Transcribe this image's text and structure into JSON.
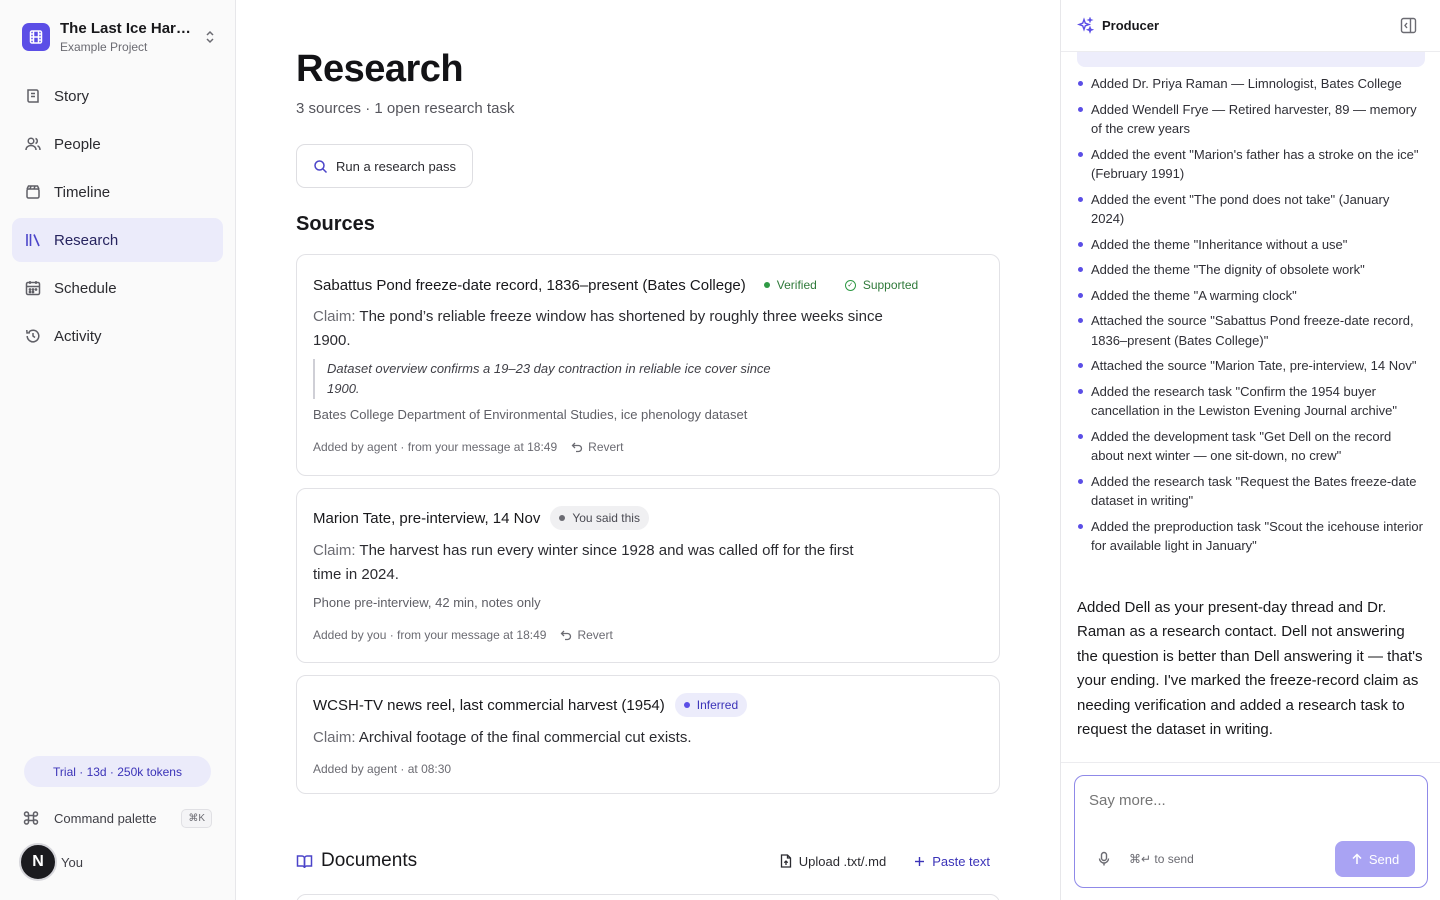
{
  "project": {
    "name": "The Last Ice Harvest",
    "subtitle": "Example Project"
  },
  "nav": [
    {
      "label": "Story",
      "icon": "story-icon",
      "active": false
    },
    {
      "label": "People",
      "icon": "people-icon",
      "active": false
    },
    {
      "label": "Timeline",
      "icon": "timeline-icon",
      "active": false
    },
    {
      "label": "Research",
      "icon": "research-icon",
      "active": true
    },
    {
      "label": "Schedule",
      "icon": "calendar-icon",
      "active": false
    },
    {
      "label": "Activity",
      "icon": "history-icon",
      "active": false
    }
  ],
  "trial": "Trial · 13d · 250k tokens",
  "command_palette": {
    "label": "Command palette",
    "shortcut": "⌘K"
  },
  "user": {
    "initial": "N",
    "name": "You"
  },
  "page": {
    "title": "Research",
    "subtitle": "3 sources · 1 open research task",
    "research_button": "Run a research pass",
    "sources_title": "Sources"
  },
  "sources": [
    {
      "title": "Sabattus Pond freeze-date record, 1836–present (Bates College)",
      "badges": [
        "Verified",
        "Supported"
      ],
      "claim_label": "Claim:",
      "claim": "The pond’s reliable freeze window has shortened by roughly three weeks since 1900.",
      "quote": "Dataset overview confirms a 19–23 day contraction in reliable ice cover since 1900.",
      "note": "Bates College Department of Environmental Studies, ice phenology dataset",
      "meta": "Added by agent · from your message at 18:49",
      "revert": "Revert"
    },
    {
      "title": "Marion Tate, pre-interview, 14 Nov",
      "badge": "You said this",
      "claim_label": "Claim:",
      "claim": "The harvest has run every winter since 1928 and was called off for the first time in 2024.",
      "note": "Phone pre-interview, 42 min, notes only",
      "meta": "Added by you · from your message at 18:49",
      "revert": "Revert"
    },
    {
      "title": "WCSH-TV news reel, last commercial harvest (1954)",
      "badge": "Inferred",
      "claim_label": "Claim:",
      "claim": "Archival footage of the final commercial cut exists.",
      "meta": "Added by agent · at 08:30"
    }
  ],
  "documents": {
    "title": "Documents",
    "upload": "Upload .txt/.md",
    "paste": "Paste text"
  },
  "panel": {
    "title": "Producer",
    "changes": [
      "Added Dr. Priya Raman — Limnologist, Bates College",
      "Added Wendell Frye — Retired harvester, 89 — memory of the crew years",
      "Added the event \"Marion's father has a stroke on the ice\" (February 1991)",
      "Added the event \"The pond does not take\" (January 2024)",
      "Added the theme \"Inheritance without a use\"",
      "Added the theme \"The dignity of obsolete work\"",
      "Added the theme \"A warming clock\"",
      "Attached the source \"Sabattus Pond freeze-date record, 1836–present (Bates College)\"",
      "Attached the source \"Marion Tate, pre-interview, 14 Nov\"",
      "Added the research task \"Confirm the 1954 buyer cancellation in the Lewiston Evening Journal archive\"",
      "Added the development task \"Get Dell on the record about next winter — one sit-down, no crew\"",
      "Added the research task \"Request the Bates freeze-date dataset in writing\"",
      "Added the preproduction task \"Scout the icehouse interior for available light in January\""
    ],
    "reply": "Added Dell as your present-day thread and Dr. Raman as a research contact. Dell not answering the question is better than Dell answering it — that's your ending. I've marked the freeze-record claim as needing verification and added a research task to request the dataset in writing.",
    "composer": {
      "placeholder": "Say more...",
      "hint": "⌘↵ to send",
      "send": "Send"
    }
  },
  "colors": {
    "accent": "#5b4ee6",
    "active_bg": "#ebebfa",
    "verified": "#2f9a45"
  }
}
